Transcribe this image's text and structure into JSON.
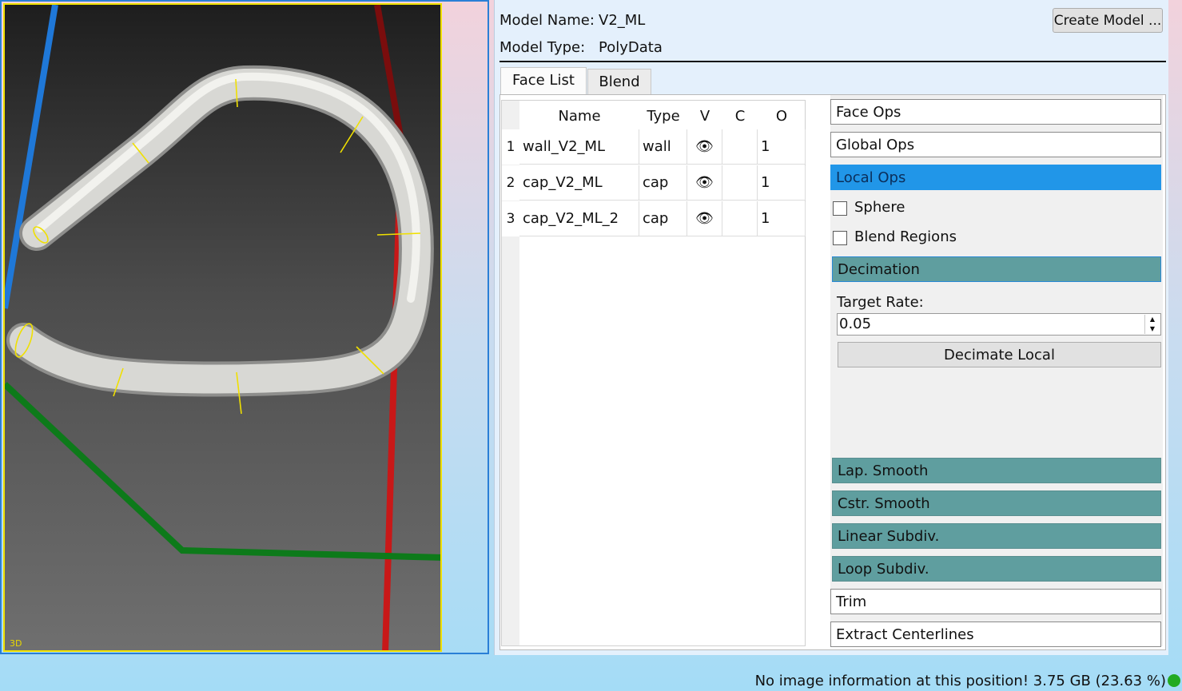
{
  "viewer": {
    "label": "3D"
  },
  "model": {
    "name_label": "Model Name:",
    "name_value": "V2_ML",
    "type_label": "Model Type:",
    "type_value": "PolyData",
    "create_button": "Create Model ..."
  },
  "tabs": [
    {
      "label": "Face List",
      "active": true
    },
    {
      "label": "Blend",
      "active": false
    }
  ],
  "face_table": {
    "columns": [
      "Name",
      "Type",
      "V",
      "C",
      "O"
    ],
    "rows": [
      {
        "num": "1",
        "name": "wall_V2_ML",
        "type": "wall",
        "v": "eye-icon",
        "c": "",
        "o": "1"
      },
      {
        "num": "2",
        "name": "cap_V2_ML",
        "type": "cap",
        "v": "eye-icon",
        "c": "",
        "o": "1"
      },
      {
        "num": "3",
        "name": "cap_V2_ML_2",
        "type": "cap",
        "v": "eye-icon",
        "c": "",
        "o": "1"
      }
    ]
  },
  "ops": {
    "face_ops": "Face Ops",
    "global_ops": "Global Ops",
    "local_ops": "Local Ops",
    "sphere": "Sphere",
    "blend_regions": "Blend Regions",
    "decimation": "Decimation",
    "target_rate_label": "Target Rate:",
    "target_rate_value": "0.05",
    "decimate_local": "Decimate Local",
    "lap_smooth": "Lap. Smooth",
    "cstr_smooth": "Cstr. Smooth",
    "linear_subdiv": "Linear Subdiv.",
    "loop_subdiv": "Loop Subdiv.",
    "trim": "Trim",
    "extract_centerlines": "Extract Centerlines"
  },
  "status": {
    "text": "No image information at this position! 3.75 GB (23.63 %)"
  },
  "colors": {
    "accent": "#2196e8",
    "teal": "#5f9e9f",
    "viewer_border": "#f0e000"
  }
}
